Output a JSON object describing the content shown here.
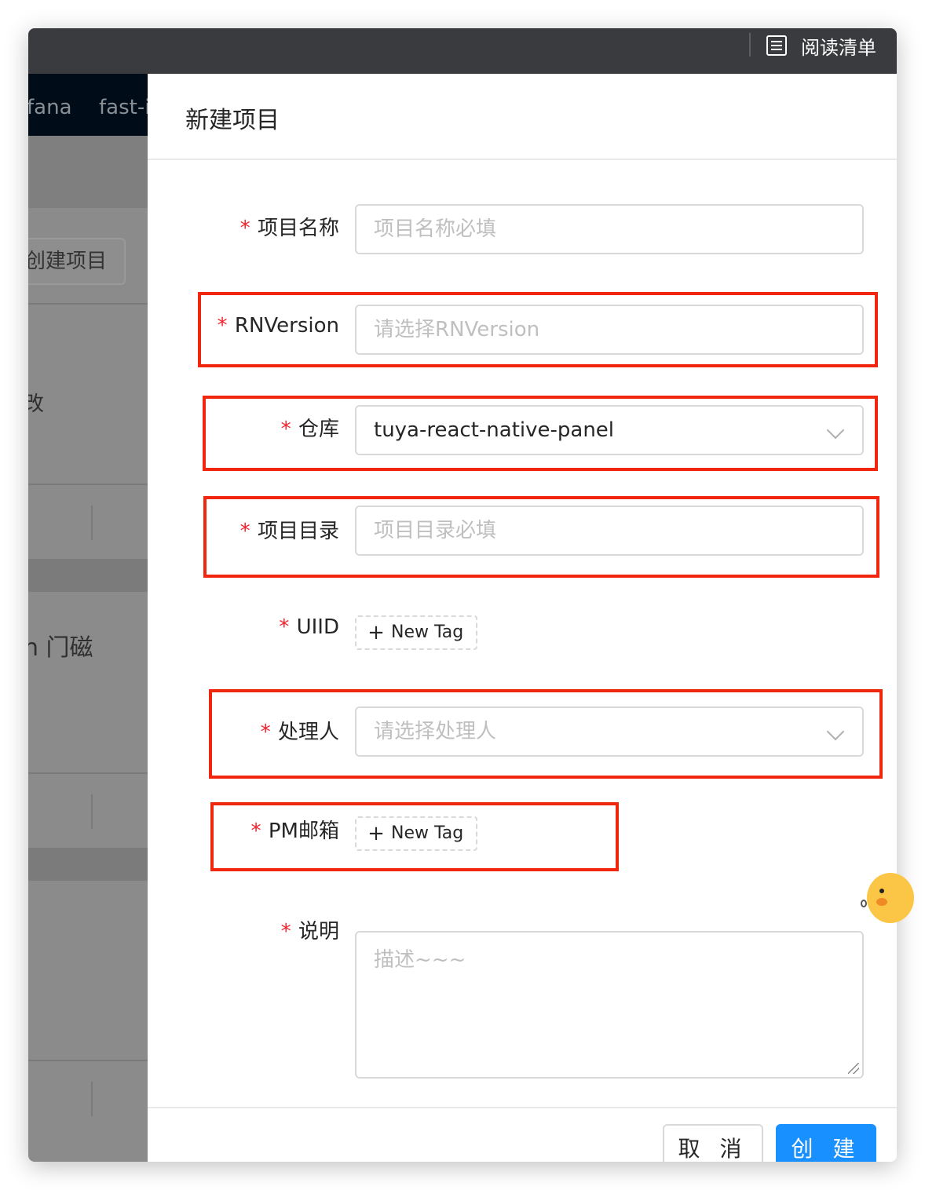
{
  "titlebar": {
    "reading_list": "阅读清单"
  },
  "background": {
    "nav_items": [
      "fana",
      "fast-i"
    ],
    "create_button": "创建项目",
    "edit_text": "改",
    "row_text": "n 门磁"
  },
  "drawer": {
    "title": "新建项目",
    "fields": {
      "project_name": {
        "label": "项目名称",
        "placeholder": "项目名称必填"
      },
      "rn_version": {
        "label": "RNVersion",
        "placeholder": "请选择RNVersion"
      },
      "repository": {
        "label": "仓库",
        "value": "tuya-react-native-panel"
      },
      "project_dir": {
        "label": "项目目录",
        "placeholder": "项目目录必填"
      },
      "uiid": {
        "label": "UIID",
        "tag_button": "New Tag"
      },
      "handler": {
        "label": "处理人",
        "placeholder": "请选择处理人"
      },
      "pm_email": {
        "label": "PM邮箱",
        "tag_button": "New Tag"
      },
      "description": {
        "label": "说明",
        "placeholder": "描述~~~"
      }
    },
    "required_mark": "*",
    "footer": {
      "cancel": "取 消",
      "create": "创 建"
    }
  },
  "colors": {
    "primary": "#1890ff",
    "required": "#f5222d",
    "highlight": "#f0260e",
    "titlebar": "#3a3b3e"
  },
  "icons": {
    "reading_list": "list-icon",
    "dropdown": "chevron-down-icon",
    "tag_add": "plus-icon"
  }
}
